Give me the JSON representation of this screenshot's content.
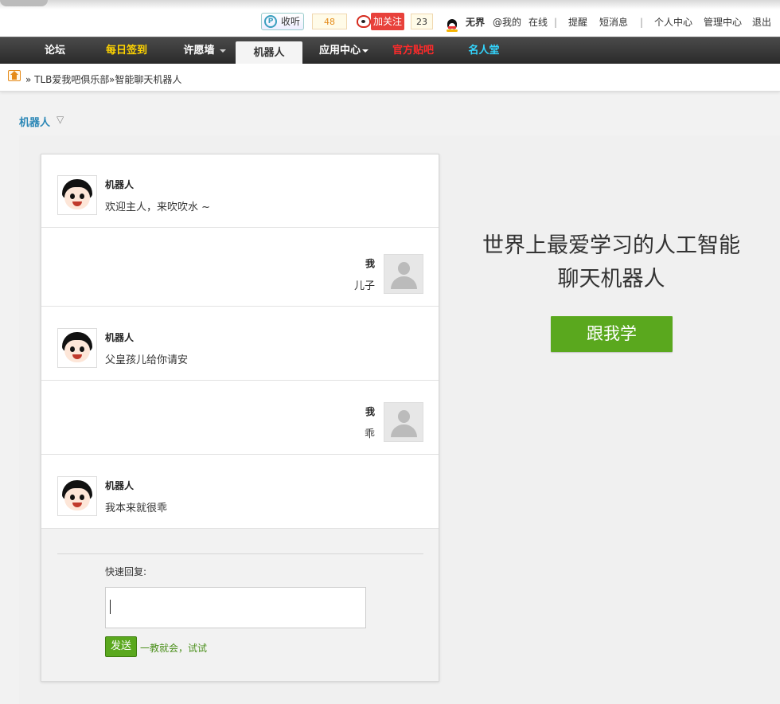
{
  "topbar": {
    "listen_label": "收听",
    "listen_count": "48",
    "weibo_label": "加关注",
    "weibo_count": "23",
    "username": "无界",
    "at_me": "@我的",
    "online": "在线",
    "sep1": "|",
    "remind": "提醒",
    "messages": "短消息",
    "sep2": "|",
    "personal_center": "个人中心",
    "admin_center": "管理中心",
    "logout": "退出"
  },
  "nav": {
    "items": [
      {
        "label": "论坛",
        "color": "#ffffff"
      },
      {
        "label": "每日签到",
        "color": "#ffd400"
      },
      {
        "label": "许愿墙",
        "color": "#ffffff"
      },
      {
        "label": "机器人",
        "color": "#333333"
      },
      {
        "label": "应用中心",
        "color": "#ffffff"
      },
      {
        "label": "官方贴吧",
        "color": "#ff2a2a"
      },
      {
        "label": "名人堂",
        "color": "#33d6ff"
      }
    ]
  },
  "breadcrumb": {
    "items": [
      "» TLB爱我吧俱乐部",
      "»智能聊天机器人"
    ]
  },
  "section": {
    "title": "机器人",
    "caret": "▽"
  },
  "chat": {
    "messages": [
      {
        "role": "bot",
        "name": "机器人",
        "text": "欢迎主人，来吹吹水 ~"
      },
      {
        "role": "user",
        "name": "我",
        "text": "儿子"
      },
      {
        "role": "bot",
        "name": "机器人",
        "text": "父皇孩儿给你请安"
      },
      {
        "role": "user",
        "name": "我",
        "text": "乖"
      },
      {
        "role": "bot",
        "name": "机器人",
        "text": "我本来就很乖"
      }
    ],
    "reply_label": "快速回复:",
    "input_value": "",
    "send_label": "发送",
    "hint": "一教就会，试试"
  },
  "promo": {
    "line1": "世界上最爱学习的人工智能",
    "line2": "聊天机器人",
    "button": "跟我学"
  },
  "colors": {
    "accent_green": "#5aa81e",
    "link_blue": "#2b87b6",
    "nav_dark": "#333333"
  }
}
